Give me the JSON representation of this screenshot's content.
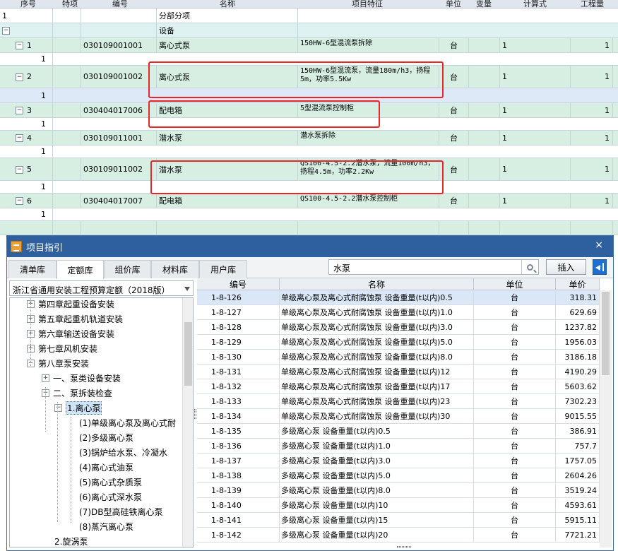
{
  "bg_table": {
    "headers": [
      "序号",
      "特项",
      "编号",
      "名称",
      "项目特征",
      "单位",
      "变量",
      "计算式",
      "工程量"
    ],
    "rows": [
      {
        "kind": "sep",
        "seq": "1",
        "name": "分部分项"
      },
      {
        "kind": "grp",
        "expander": "−",
        "name": "设备"
      },
      {
        "kind": "item",
        "expander": "−",
        "seq": "1",
        "code": "030109001001",
        "name": "离心式泵",
        "feature": "150HW-6型混流泵拆除",
        "unit": "台",
        "calc": "1",
        "qty": "1"
      },
      {
        "kind": "sub",
        "seq": "1"
      },
      {
        "kind": "item",
        "expander": "−",
        "seq": "2",
        "code": "030109001002",
        "name": "离心式泵",
        "feature": "150HW-6型混流泵，流量180m/h3，扬程5m，功率5.5Kw",
        "unit": "台",
        "calc": "1",
        "qty": "1"
      },
      {
        "kind": "selsub",
        "seq": "1"
      },
      {
        "kind": "item",
        "expander": "−",
        "seq": "3",
        "code": "030404017006",
        "name": "配电箱",
        "feature": "5型混流泵控制柜",
        "unit": "台",
        "calc": "1",
        "qty": "1"
      },
      {
        "kind": "sub",
        "seq": "1"
      },
      {
        "kind": "item",
        "expander": "−",
        "seq": "4",
        "code": "030109011001",
        "name": "潜水泵",
        "feature": "潜水泵拆除",
        "unit": "台",
        "calc": "1",
        "qty": "1"
      },
      {
        "kind": "sub",
        "seq": "1"
      },
      {
        "kind": "item",
        "expander": "−",
        "seq": "5",
        "code": "030109011002",
        "name": "潜水泵",
        "feature": "QS100-4.5-2.2潜水泵，流量100m/h3，扬程4.5m，功率2.2Kw",
        "unit": "台",
        "calc": "1",
        "qty": "1"
      },
      {
        "kind": "sub",
        "seq": "1"
      },
      {
        "kind": "item",
        "expander": "−",
        "seq": "6",
        "code": "030404017007",
        "name": "配电箱",
        "feature": "QS100-4.5-2.2潜水泵控制柜",
        "unit": "台",
        "calc": "1",
        "qty": "1"
      },
      {
        "kind": "sub",
        "seq": "1"
      },
      {
        "kind": "item",
        "expander": "",
        "seq": "",
        "code": "",
        "name": "",
        "feature": "",
        "unit": "",
        "calc": "",
        "qty": ""
      }
    ]
  },
  "dialog": {
    "title": "项目指引",
    "close": "×",
    "tabs": [
      "清单库",
      "定额库",
      "组价库",
      "材料库",
      "用户库"
    ],
    "active_tab": 1,
    "search_value": "水泵",
    "insert_label": "插入",
    "library": "浙江省通用安装工程预算定额（2018版）",
    "tree": [
      {
        "label": "第四章起重设备安装",
        "expander": "+"
      },
      {
        "label": "第五章起重机轨道安装",
        "expander": "+"
      },
      {
        "label": "第六章输送设备安装",
        "expander": "+"
      },
      {
        "label": "第七章风机安装",
        "expander": "+"
      },
      {
        "label": "第八章泵安装",
        "expander": "−"
      },
      {
        "label": "一、泵类设备安装",
        "expander": "+"
      },
      {
        "label": "二、泵拆装检查",
        "expander": "−"
      },
      {
        "label": "1.离心泵",
        "expander": "−"
      },
      {
        "label": "(1)单级离心泵及离心式耐",
        "expander": ""
      },
      {
        "label": "(2)多级离心泵",
        "expander": ""
      },
      {
        "label": "(3)锅炉给水泵、冷凝水",
        "expander": ""
      },
      {
        "label": "(4)离心式油泵",
        "expander": ""
      },
      {
        "label": "(5)离心式杂质泵",
        "expander": ""
      },
      {
        "label": "(6)离心式深水泵",
        "expander": ""
      },
      {
        "label": "(7)DB型高硅铁离心泵",
        "expander": ""
      },
      {
        "label": "(8)蒸汽离心泵",
        "expander": ""
      },
      {
        "label": "2.旋涡泵",
        "expander": ""
      }
    ],
    "grid_headers": [
      "编号",
      "名称",
      "单位",
      "单价"
    ],
    "grid_rows": [
      {
        "code": "1-8-126",
        "name": "单级离心泵及离心式耐腐蚀泵 设备重量(t以内)0.5",
        "unit": "台",
        "price": "318.31"
      },
      {
        "code": "1-8-127",
        "name": "单级离心泵及离心式耐腐蚀泵 设备重量(t以内)1.0",
        "unit": "台",
        "price": "629.69"
      },
      {
        "code": "1-8-128",
        "name": "单级离心泵及离心式耐腐蚀泵 设备重量(t以内)3.0",
        "unit": "台",
        "price": "1237.82"
      },
      {
        "code": "1-8-129",
        "name": "单级离心泵及离心式耐腐蚀泵 设备重量(t以内)5.0",
        "unit": "台",
        "price": "1956.03"
      },
      {
        "code": "1-8-130",
        "name": "单级离心泵及离心式耐腐蚀泵 设备重量(t以内)8.0",
        "unit": "台",
        "price": "3186.18"
      },
      {
        "code": "1-8-131",
        "name": "单级离心泵及离心式耐腐蚀泵 设备重量(t以内)12",
        "unit": "台",
        "price": "4190.29"
      },
      {
        "code": "1-8-132",
        "name": "单级离心泵及离心式耐腐蚀泵 设备重量(t以内)17",
        "unit": "台",
        "price": "5603.62"
      },
      {
        "code": "1-8-133",
        "name": "单级离心泵及离心式耐腐蚀泵 设备重量(t以内)23",
        "unit": "台",
        "price": "7302.23"
      },
      {
        "code": "1-8-134",
        "name": "单级离心泵及离心式耐腐蚀泵 设备重量(t以内)30",
        "unit": "台",
        "price": "9015.55"
      },
      {
        "code": "1-8-135",
        "name": "多级离心泵 设备重量(t以内)0.5",
        "unit": "台",
        "price": "386.91"
      },
      {
        "code": "1-8-136",
        "name": "多级离心泵 设备重量(t以内)1.0",
        "unit": "台",
        "price": "757.7"
      },
      {
        "code": "1-8-137",
        "name": "多级离心泵 设备重量(t以内)3.0",
        "unit": "台",
        "price": "1757.05"
      },
      {
        "code": "1-8-138",
        "name": "多级离心泵 设备重量(t以内)5.0",
        "unit": "台",
        "price": "2604.26"
      },
      {
        "code": "1-8-139",
        "name": "多级离心泵 设备重量(t以内)8.0",
        "unit": "台",
        "price": "3519.24"
      },
      {
        "code": "1-8-140",
        "name": "多级离心泵 设备重量(t以内)10",
        "unit": "台",
        "price": "4593.61"
      },
      {
        "code": "1-8-141",
        "name": "多级离心泵 设备重量(t以内)15",
        "unit": "台",
        "price": "5915.11"
      },
      {
        "code": "1-8-142",
        "name": "多级离心泵 设备重量(t以内)20",
        "unit": "台",
        "price": "7721.21"
      }
    ]
  }
}
